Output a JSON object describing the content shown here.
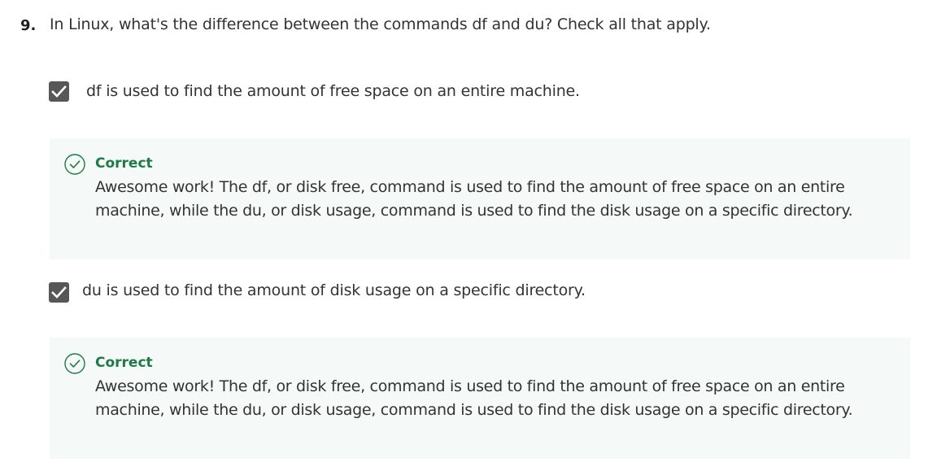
{
  "question": {
    "number": "9.",
    "text": "In Linux, what's the difference between the commands df and du? Check all that apply."
  },
  "options": [
    {
      "label": "df is used to find the amount of free space on an entire machine.",
      "checked": true,
      "feedback": {
        "status": "Correct",
        "text": "Awesome work! The df, or disk free, command is used to find the amount of free space on an entire machine, while the du, or disk usage, command is used to find the disk usage on a specific directory."
      }
    },
    {
      "label": "du is used to find the amount of disk usage on a specific directory.",
      "checked": true,
      "feedback": {
        "status": "Correct",
        "text": "Awesome work! The df, or disk free, command is used to find the amount of free space on an entire machine, while the du, or disk usage, command is used to find the disk usage on a specific directory."
      }
    }
  ],
  "colors": {
    "correct_green": "#1e7b46",
    "feedback_bg": "#f5f9f8",
    "checkbox_bg": "#575757"
  },
  "icons": {
    "checkbox": "checkmark-icon",
    "feedback": "check-circle-icon"
  }
}
